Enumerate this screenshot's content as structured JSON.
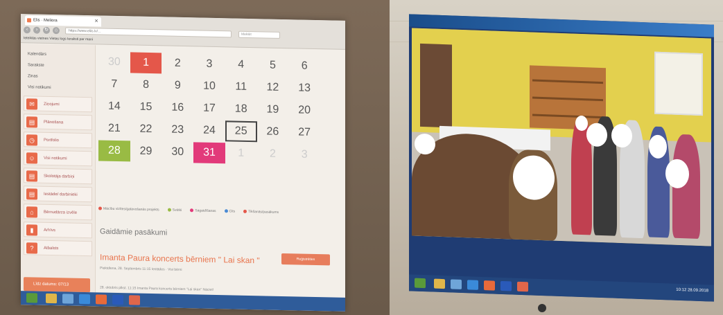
{
  "left_screen": {
    "tab_title": "Elis · Meliora",
    "url": "https://www.eliis.lv/...",
    "search_placeholder": "Meklēt",
    "bookmarks": "Ieteiktās vietnes    Vietas logs    Ieraksti par mani",
    "sidebar": {
      "subitems": [
        "Kalendārs",
        "Sarakste",
        "Zinas",
        "Visi notikumi"
      ],
      "items": [
        {
          "label": "Ziņojumi",
          "icon": "envelope-icon"
        },
        {
          "label": "Plānošana",
          "icon": "document-icon"
        },
        {
          "label": "Portfolio",
          "icon": "clock-icon"
        },
        {
          "label": "Visi notikumi",
          "icon": "person-icon"
        },
        {
          "label": "Skolotāja darbiņi",
          "icon": "document-icon"
        },
        {
          "label": "Iestāde/ darbinieki",
          "icon": "document-icon"
        },
        {
          "label": "Bērnudārza izvēle",
          "icon": "home-icon"
        },
        {
          "label": "Arhīvs",
          "icon": "lock-icon"
        },
        {
          "label": "Atbalsts",
          "icon": "help-icon"
        }
      ],
      "bottom_button": "Līdz datums: 07/13"
    },
    "calendar": {
      "cells": [
        {
          "d": "30",
          "s": "dim"
        },
        {
          "d": "1",
          "s": "red"
        },
        {
          "d": "2",
          "s": ""
        },
        {
          "d": "3",
          "s": ""
        },
        {
          "d": "4",
          "s": ""
        },
        {
          "d": "5",
          "s": ""
        },
        {
          "d": "6",
          "s": ""
        },
        {
          "d": "7",
          "s": ""
        },
        {
          "d": "8",
          "s": ""
        },
        {
          "d": "9",
          "s": ""
        },
        {
          "d": "10",
          "s": ""
        },
        {
          "d": "11",
          "s": ""
        },
        {
          "d": "12",
          "s": ""
        },
        {
          "d": "13",
          "s": ""
        },
        {
          "d": "14",
          "s": ""
        },
        {
          "d": "15",
          "s": ""
        },
        {
          "d": "16",
          "s": ""
        },
        {
          "d": "17",
          "s": ""
        },
        {
          "d": "18",
          "s": ""
        },
        {
          "d": "19",
          "s": ""
        },
        {
          "d": "20",
          "s": ""
        },
        {
          "d": "21",
          "s": ""
        },
        {
          "d": "22",
          "s": ""
        },
        {
          "d": "23",
          "s": ""
        },
        {
          "d": "24",
          "s": ""
        },
        {
          "d": "25",
          "s": "today"
        },
        {
          "d": "26",
          "s": ""
        },
        {
          "d": "27",
          "s": ""
        },
        {
          "d": "28",
          "s": "green"
        },
        {
          "d": "29",
          "s": ""
        },
        {
          "d": "30",
          "s": ""
        },
        {
          "d": "31",
          "s": "pink"
        },
        {
          "d": "1",
          "s": "dim"
        },
        {
          "d": "2",
          "s": "dim"
        },
        {
          "d": "3",
          "s": "dim"
        }
      ],
      "legend": [
        {
          "label": "Mācību vizītes/gatavošanās projekts",
          "color": "#e4574a"
        },
        {
          "label": "Svētki",
          "color": "#99bb44"
        },
        {
          "label": "Sagaidīšanas",
          "color": "#e23a7a"
        },
        {
          "label": "Cits",
          "color": "#4a8ad4"
        },
        {
          "label": "Tikšanās/pasākums",
          "color": "#e4574a"
        }
      ]
    },
    "events_title": "Gaidāmie pasākumi",
    "event": {
      "title": "Imanta Paura koncerts bērniem \" Lai skan \"",
      "meta": "Piektdiena, 28. Septembris 11:15   Iestādes · Visi bērni",
      "button": "Reģistrēties",
      "description": "28. oktobris plkst. 11:15 Imanta Paura koncerts bērniem \"Lai skan\" Nāciet!"
    }
  },
  "right_screen": {
    "tray_time": "10:12",
    "tray_date": "28.09.2018"
  },
  "colors": {
    "accent": "#e8744d",
    "taskbar": "#2f5c9a",
    "calendar_red": "#e4574a",
    "calendar_pink": "#e23a7a",
    "calendar_green": "#99bb44"
  }
}
